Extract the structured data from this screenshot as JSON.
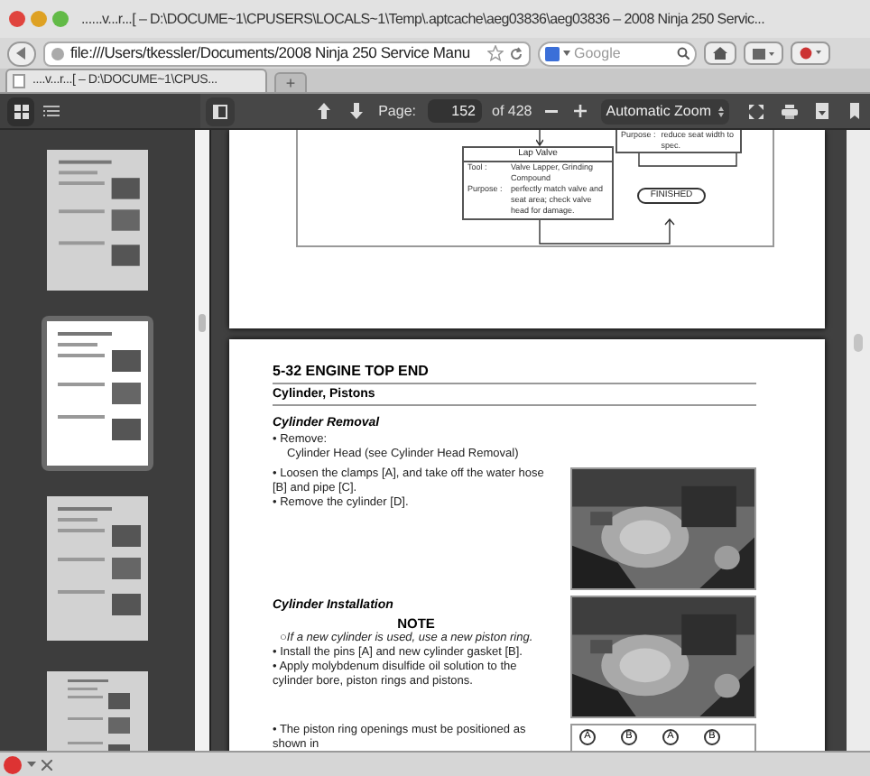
{
  "window": {
    "title": "......v...r...[ – D:\\DOCUME~1\\CPUSERS\\LOCALS~1\\Temp\\.aptcache\\aeg03836\\aeg03836 – 2008 Ninja 250 Servic..."
  },
  "navigation": {
    "url": "file:///Users/tkessler/Documents/2008 Ninja 250 Service Manu",
    "search_placeholder": "Google"
  },
  "tabs": [
    {
      "label": "....v...r...[ – D:\\DOCUME~1\\CPUS...",
      "selected": true
    }
  ],
  "new_tab": "+",
  "pdf_toolbar": {
    "page_label": "Page:",
    "page": "152",
    "page_count": "of 428",
    "zoom": "Automatic Zoom"
  },
  "sidebar": {
    "views": [
      {
        "kind": "thumbnails",
        "selected": true
      },
      {
        "kind": "outline",
        "selected": false
      }
    ],
    "thumbnails": [
      {
        "selected": false
      },
      {
        "selected": true
      },
      {
        "selected": false
      },
      {
        "selected": false
      }
    ]
  },
  "flowchart": {
    "side_box": {
      "label": "Purpose :",
      "text": "reduce seat width to spec."
    },
    "main_box": {
      "title": "Lap Valve",
      "rows": [
        {
          "label": "Tool :",
          "text": "Valve Lapper, Grinding Compound"
        },
        {
          "label": "Purpose :",
          "text": "perfectly match valve and seat area; check valve head for damage."
        }
      ]
    },
    "end": "FINISHED"
  },
  "page": {
    "section_header": "5-32 ENGINE TOP END",
    "title": "Cylinder, Pistons",
    "sections": [
      {
        "heading": "Cylinder Removal",
        "kind": "text",
        "blocks": [
          {
            "kind": "bullet",
            "text": "• Remove:"
          },
          {
            "kind": "indent",
            "text": "Cylinder Head (see Cylinder Head Removal)"
          }
        ]
      },
      {
        "blocks": [
          {
            "kind": "bullet",
            "text": "• Loosen the clamps [A], and take off the water hose [B] and pipe [C]."
          },
          {
            "kind": "bullet",
            "text": "• Remove the cylinder [D]."
          }
        ]
      },
      {
        "heading": "Cylinder Installation",
        "blocks": [
          {
            "kind": "note_title",
            "text": "NOTE"
          },
          {
            "kind": "note",
            "text": "○If a new cylinder is used, use a new piston ring."
          },
          {
            "kind": "bullet",
            "text": "• Install the pins [A] and new cylinder gasket [B]."
          },
          {
            "kind": "bullet",
            "text": "• Apply molybdenum disulfide oil solution to the cylinder bore, piston rings and pistons."
          }
        ]
      },
      {
        "kind": "diagram",
        "figure_labels": [
          "A",
          "B",
          "A",
          "B"
        ],
        "blocks": [
          {
            "kind": "bullet",
            "text": "• The piston ring openings must be positioned as shown in"
          }
        ]
      }
    ]
  }
}
